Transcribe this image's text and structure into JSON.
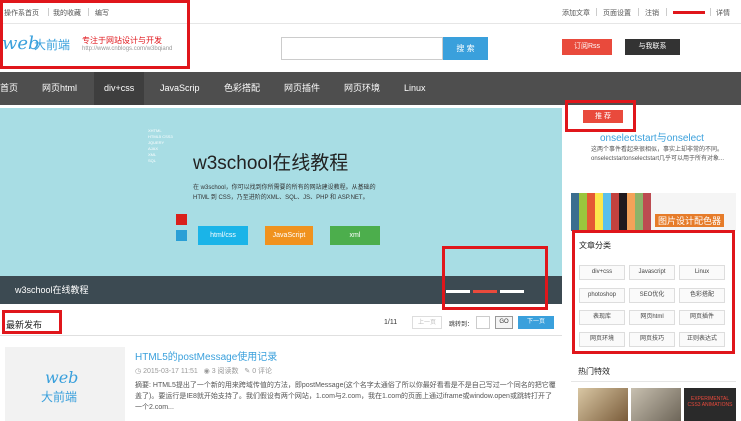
{
  "topbar": {
    "left_links": [
      "操作系首页",
      "我的收藏",
      "编写"
    ],
    "right_links": [
      "添加文章",
      "页面设置",
      "注销",
      "详情"
    ]
  },
  "logo": {
    "web": "web",
    "cn": "大前端",
    "slogan": "专注于网站设计与开发",
    "url": "http://www.cnblogs.com/w3bqiand"
  },
  "search": {
    "placeholder": "",
    "button": "搜 索"
  },
  "header_buttons": {
    "rss": "订阅Rss",
    "contact": "与我联系"
  },
  "nav": [
    "首页",
    "网页html",
    "div+css",
    "JavaScrip",
    "色彩搭配",
    "网页插件",
    "网页环境",
    "Linux"
  ],
  "banner": {
    "title": "w3school在线教程",
    "desc": "在 w3school，你可以找到你所需要的所有的网站建设教程。从基础的 HTML 到 CSS，乃至进阶的XML、SQL、JS、PHP 和 ASP.NET。",
    "tags": [
      "XHTML",
      "HTML5 CSS3",
      "JQUERY",
      "AJAX",
      "XML",
      "SQL"
    ],
    "buttons": [
      "html/css",
      "JavaScript",
      "xml"
    ],
    "caption": "w3school在线教程",
    "colors": {
      "html_css": "#1ab4e8",
      "javascript": "#f0921e",
      "xml": "#4cae4c"
    }
  },
  "latest": {
    "title": "最新发布",
    "page_count": "1/11",
    "prev": "上一页",
    "jump_label": "跳转到：",
    "go": "GO",
    "next": "下一页"
  },
  "post": {
    "thumb_web": "web",
    "thumb_cn": "大前端",
    "title": "HTML5的postMessage使用记录",
    "date": "2015-03-17 11:51",
    "views": "3 阅读数",
    "comments": "0 评论",
    "summary": "摘要: HTML5提出了一个新的用来跨域传值的方法，即postMessage(这个名字太通俗了所以你最好看看是不是自己写过一个同名的把它覆盖了)。要运行是IE8就开始支持了。我们假设有两个网站，1.com与2.com，我在1.com的页面上通过iframe或window.open或跳转打开了一个2.com..."
  },
  "sidebar": {
    "recommend_button": "推 荐",
    "recommend_title": "onselectstart与onselect",
    "recommend_desc": "这两个事件看起来很相似，事实上却非常的不同。onselectstartonselectstart几乎可以用于所有对象...",
    "palette_label": "图片设计配色器",
    "categories_title": "文章分类",
    "categories": [
      "div+css",
      "Javascript",
      "Linux",
      "photoshop",
      "SEO优化",
      "色彩搭配",
      "表现库",
      "网页html",
      "网页插件",
      "网页环境",
      "网页技巧",
      "正则表达式"
    ],
    "hot_title": "热门特效",
    "hot_img3_text": "EXPERIMENTAL CSS3 ANIMATIONS"
  }
}
